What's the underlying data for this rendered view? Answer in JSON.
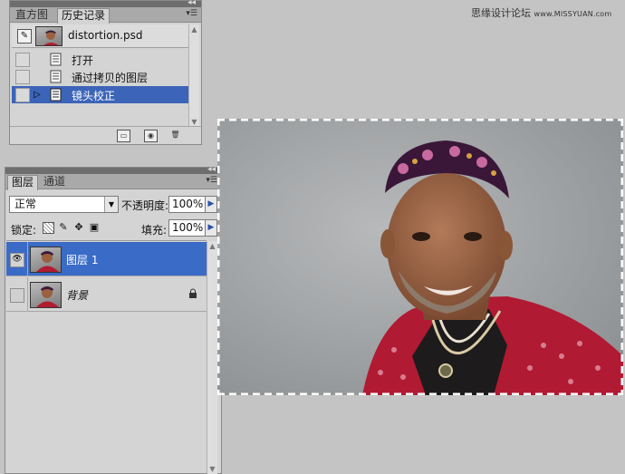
{
  "watermark": {
    "cn": "思缘设计论坛",
    "url": "www.MISSYUAN.com"
  },
  "history": {
    "tabs": [
      {
        "label": "直方图"
      },
      {
        "label": "历史记录"
      }
    ],
    "snapshot": {
      "name": "distortion.psd"
    },
    "items": [
      {
        "label": "打开"
      },
      {
        "label": "通过拷贝的图层"
      },
      {
        "label": "镜头校正",
        "selected": true
      }
    ],
    "footer_icons": [
      "new-document-icon",
      "camera-icon",
      "trash-icon"
    ]
  },
  "layers": {
    "tabs": [
      {
        "label": "图层"
      },
      {
        "label": "通道"
      }
    ],
    "blend_mode": "正常",
    "opacity_label": "不透明度:",
    "opacity_value": "100%",
    "lock_label": "锁定:",
    "fill_label": "填充:",
    "fill_value": "100%",
    "rows": [
      {
        "name": "图层 1",
        "visible": true,
        "selected": true
      },
      {
        "name": "背景",
        "visible": false,
        "locked": true
      }
    ]
  },
  "colors": {
    "selection": "#3a6bc7",
    "panel": "#d4d4d4",
    "workspace": "#c4c4c4"
  }
}
